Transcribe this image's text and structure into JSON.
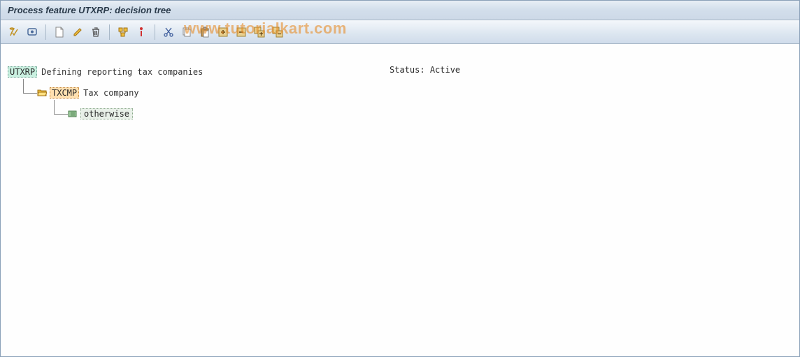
{
  "title": "Process feature UTXRP: decision tree",
  "watermark": "www.tutorialkart.com",
  "status_label": "Status:",
  "status_value": "Active",
  "toolbar": {
    "check": "Check",
    "display": "Display",
    "create": "Create",
    "change": "Change",
    "delete": "Delete",
    "where_used": "Where-used",
    "info": "Info",
    "cut": "Cut",
    "copy": "Copy",
    "paste": "Paste",
    "expand": "Expand",
    "collapse": "Collapse",
    "expand_all": "Expand all",
    "collapse_all": "Collapse all"
  },
  "tree": {
    "root_code": "UTXRP",
    "root_label": "Defining reporting tax companies",
    "child_code": "TXCMP",
    "child_label": "Tax company",
    "leaf_label": "otherwise"
  }
}
